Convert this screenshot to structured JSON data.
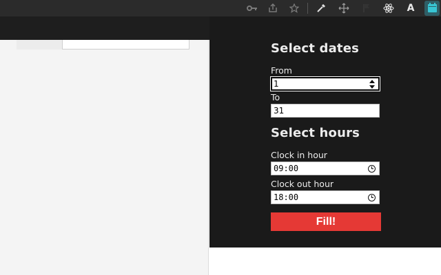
{
  "toolbar": {
    "icons": [
      "key-icon",
      "share-icon",
      "star-icon",
      "eyedropper-icon",
      "move-icon",
      "flag-icon",
      "react-icon",
      "font-a-icon",
      "calendar-extension-icon"
    ],
    "font_a_label": "A"
  },
  "popup": {
    "dates_heading": "Select dates",
    "from_label": "From",
    "from_value": "1",
    "to_label": "To",
    "to_value": "31",
    "hours_heading": "Select hours",
    "clock_in_label": "Clock in hour",
    "clock_in_value": "09:00",
    "clock_out_label": "Clock out hour",
    "clock_out_value": "18:00",
    "fill_button": "Fill!"
  },
  "colors": {
    "popup_bg": "#1a1a1a",
    "button_bg": "#e53935",
    "accent_icon": "#38c5d4"
  }
}
